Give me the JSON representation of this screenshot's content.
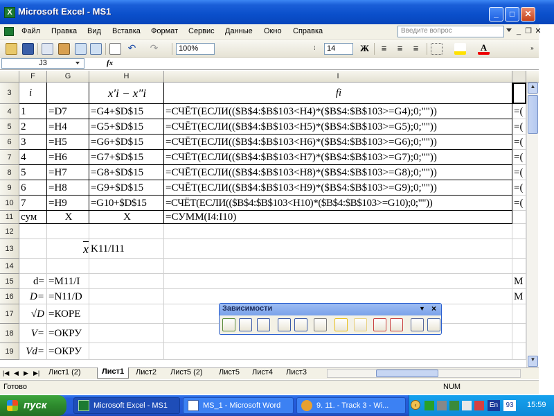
{
  "window": {
    "title": "Microsoft Excel - MS1",
    "min_label": "_",
    "max_label": "□",
    "close_label": "✕"
  },
  "menu": {
    "items": [
      "Файл",
      "Правка",
      "Вид",
      "Вставка",
      "Формат",
      "Сервис",
      "Данные",
      "Окно",
      "Справка"
    ],
    "ask_placeholder": "Введите вопрос"
  },
  "toolbar": {
    "zoom": "100%",
    "font_size": "14"
  },
  "formula_bar": {
    "name_box": "J3",
    "fx_label": "fx",
    "formula": ""
  },
  "columns": [
    "F",
    "G",
    "H",
    "I"
  ],
  "rows": [
    {
      "num": "3",
      "F": "i",
      "G": "",
      "H": "x′i − x″i",
      "I": "fi",
      "J": ""
    },
    {
      "num": "4",
      "F": "1",
      "G": "=D7",
      "H": "=G4+$D$15",
      "I": "=СЧЁТ(ЕСЛИ(($B$4:$B$103<H4)*($B$4:$B$103>=G4);0;\"\"))",
      "J": "=("
    },
    {
      "num": "5",
      "F": "2",
      "G": "=H4",
      "H": "=G5+$D$15",
      "I": "=СЧЁТ(ЕСЛИ(($B$4:$B$103<H5)*($B$4:$B$103>=G5);0;\"\"))",
      "J": "=("
    },
    {
      "num": "6",
      "F": "3",
      "G": "=H5",
      "H": "=G6+$D$15",
      "I": "=СЧЁТ(ЕСЛИ(($B$4:$B$103<H6)*($B$4:$B$103>=G6);0;\"\"))",
      "J": "=("
    },
    {
      "num": "7",
      "F": "4",
      "G": "=H6",
      "H": "=G7+$D$15",
      "I": "=СЧЁТ(ЕСЛИ(($B$4:$B$103<H7)*($B$4:$B$103>=G7);0;\"\"))",
      "J": "=("
    },
    {
      "num": "8",
      "F": "5",
      "G": "=H7",
      "H": "=G8+$D$15",
      "I": "=СЧЁТ(ЕСЛИ(($B$4:$B$103<H8)*($B$4:$B$103>=G8);0;\"\"))",
      "J": "=("
    },
    {
      "num": "9",
      "F": "6",
      "G": "=H8",
      "H": "=G9+$D$15",
      "I": "=СЧЁТ(ЕСЛИ(($B$4:$B$103<H9)*($B$4:$B$103>=G9);0;\"\"))",
      "J": "=("
    },
    {
      "num": "10",
      "F": "7",
      "G": "=H9",
      "H": "=G10+$D$15",
      "I": "=СЧЁТ(ЕСЛИ(($B$4:$B$103<H10)*($B$4:$B$103>=G10);0;\"\"))",
      "J": "=("
    },
    {
      "num": "11",
      "F": "сум",
      "G": "X",
      "H": "X",
      "I": "=СУММ(I4:I10)",
      "J": ""
    },
    {
      "num": "12",
      "F": "",
      "G": "",
      "H": "",
      "I": "",
      "J": ""
    },
    {
      "num": "13",
      "F": "",
      "G": "x",
      "H": "K11/I11",
      "I": "",
      "J": ""
    },
    {
      "num": "14",
      "F": "",
      "G": "",
      "H": "",
      "I": "",
      "J": ""
    },
    {
      "num": "15",
      "F": "d=",
      "G": "=M11/I",
      "H": "",
      "I": "",
      "J": "M"
    },
    {
      "num": "16",
      "F": "D=",
      "G": "=N11/D",
      "H": "",
      "I": "",
      "J": "M"
    },
    {
      "num": "17",
      "F": "√D",
      "G": "=КОРЕ",
      "H": "",
      "I": "",
      "J": ""
    },
    {
      "num": "18",
      "F": "V=",
      "G": "=ОКРУ",
      "H": "",
      "I": "",
      "J": ""
    },
    {
      "num": "19",
      "F": "Vd=",
      "G": "=ОКРУ",
      "H": "",
      "I": "",
      "J": ""
    }
  ],
  "sheets": {
    "tabs": [
      "Лист1 (2)",
      "Лист1",
      "Лист2",
      "Лист5 (2)",
      "Лист5",
      "Лист4",
      "Лист3"
    ],
    "active": "Лист1"
  },
  "status": {
    "left": "Готово",
    "num": "NUM"
  },
  "dependencies_toolbar": {
    "title": "Зависимости"
  },
  "taskbar": {
    "start": "пуск",
    "tasks": [
      "Microsoft Excel - MS1",
      "MS_1 - Microsoft Word",
      "9. 11. - Track  3 - Wi..."
    ],
    "lang": "En",
    "badge": "93",
    "clock": "15:59"
  },
  "colors": {
    "title_blue": "#0a4fcb",
    "taskbar_blue": "#245edb",
    "start_green": "#2d8a2d",
    "tray_blue": "#0e8ad8"
  }
}
